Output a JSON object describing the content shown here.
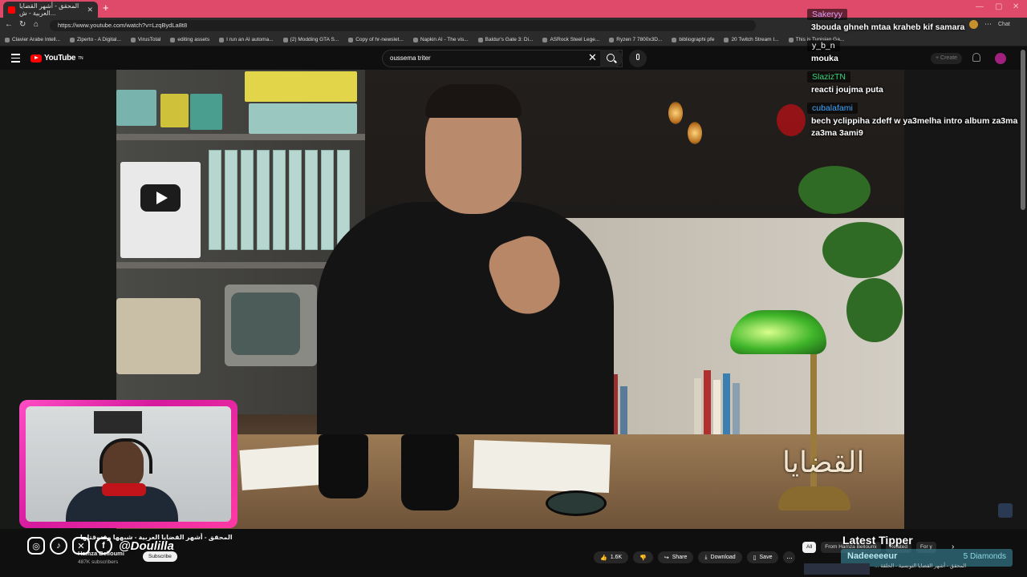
{
  "browser": {
    "tab_title": "المحقق - أشهر القضايا العربية - ش...",
    "url": "https://www.youtube.com/watch?v=LzqBydLa8t8",
    "bookmarks": [
      "Clavier Arabe Intell...",
      "Ziperto - A Digital...",
      "VirusTotal",
      "editing assets",
      "I run an AI automa...",
      "(2) Modding GTA S...",
      "Copy of hr-newslet...",
      "Napkin AI - The vis...",
      "Baldur's Gate 3: Di...",
      "ASRock Steel Lege...",
      "Ryzen 7 7800x3D...",
      "bibliographi pfe",
      "20 Twitch Stream I...",
      "This is Tunisian Ga..."
    ]
  },
  "youtube": {
    "logo_text": "YouTube",
    "logo_sup": "TN",
    "search_value": "oussema triter",
    "create_label": "Create"
  },
  "chat": [
    {
      "user": "Sakeryy",
      "color": "#d6a2ff",
      "text": "3bouda ghneh mtaa kraheb kif samara"
    },
    {
      "user": "y_b_n",
      "color": "#ffffff",
      "text": "mouka"
    },
    {
      "user": "SlazizTN",
      "color": "#37d67a",
      "text": "reacti joujma puta"
    },
    {
      "user": "cubalafami",
      "color": "#3ea6ff",
      "text": "bech yclippiha zdeff w ya3melha intro album za3ma za3ma 3ami9"
    }
  ],
  "chat_controls": {
    "chat_label": "Chat"
  },
  "overlay": {
    "handle": "@Doulilla",
    "latest_tipper_label": "Latest Tipper",
    "tipper_name": "Nadeeeeeur",
    "tipper_amount": "5 Diamonds",
    "video_watermark": "القضايا"
  },
  "video": {
    "title": "المحقق - أشهر القضايا العربية - شبهها وقتوقتلها",
    "channel": "Hamza Belloumi",
    "subscribers": "487K subscribers",
    "subscribe_label": "Subscribe",
    "likes": "1.6K",
    "share_label": "Share",
    "download_label": "Download",
    "save_label": "Save",
    "more_label": "..."
  },
  "related": {
    "chips": [
      "All",
      "From Hamza Belloumi",
      "Related",
      "For y"
    ],
    "first_title": "المحقق - أشهر القضايا التونسية - الحلقة ..."
  }
}
